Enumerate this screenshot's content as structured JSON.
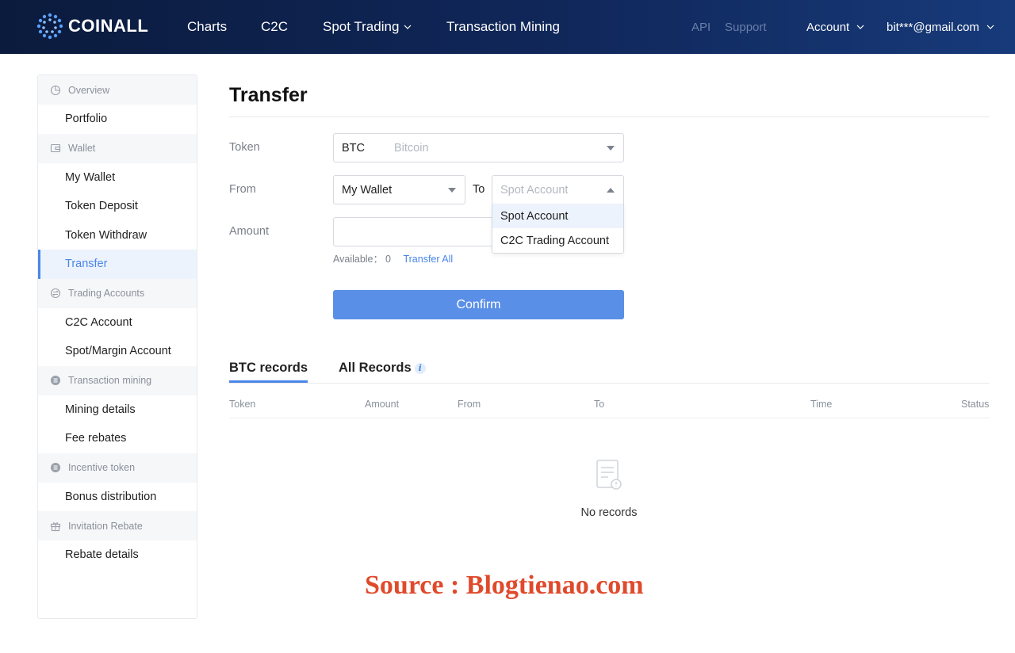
{
  "header": {
    "logo_text": "COINALL",
    "nav": [
      {
        "label": "Charts"
      },
      {
        "label": "C2C"
      },
      {
        "label": "Spot Trading"
      },
      {
        "label": "Transaction Mining"
      }
    ],
    "right": {
      "api": "API",
      "support": "Support",
      "account": "Account",
      "user": "bit***@gmail.com"
    }
  },
  "sidebar": {
    "groups": [
      {
        "label": "Overview",
        "icon": "pie-chart-icon",
        "items": [
          "Portfolio"
        ]
      },
      {
        "label": "Wallet",
        "icon": "wallet-icon",
        "items": [
          "My Wallet",
          "Token Deposit",
          "Token Withdraw",
          "Transfer"
        ]
      },
      {
        "label": "Trading Accounts",
        "icon": "exchange-icon",
        "items": [
          "C2C Account",
          "Spot/Margin Account"
        ]
      },
      {
        "label": "Transaction mining",
        "icon": "mining-icon",
        "items": [
          "Mining details",
          "Fee rebates"
        ]
      },
      {
        "label": "Incentive token",
        "icon": "token-icon",
        "items": [
          "Bonus distribution"
        ]
      },
      {
        "label": "Invitation Rebate",
        "icon": "gift-icon",
        "items": [
          "Rebate details"
        ]
      }
    ],
    "active_item": "Transfer"
  },
  "transfer": {
    "title": "Transfer",
    "token_label": "Token",
    "token_symbol": "BTC",
    "token_name": "Bitcoin",
    "from_label": "From",
    "from_value": "My Wallet",
    "to_label": "To",
    "to_placeholder": "Spot Account",
    "to_options": [
      "Spot Account",
      "C2C Trading Account"
    ],
    "amount_label": "Amount",
    "amount_value": "",
    "available_label": "Available：",
    "available_value": "0",
    "transfer_all": "Transfer All",
    "confirm": "Confirm"
  },
  "records": {
    "tabs": [
      {
        "label": "BTC records"
      },
      {
        "label": "All Records"
      }
    ],
    "info_glyph": "i",
    "columns": [
      "Token",
      "Amount",
      "From",
      "To",
      "Time",
      "Status"
    ],
    "empty_text": "No records"
  },
  "watermark": "Source : Blogtienao.com",
  "colors": {
    "accent": "#4a86e8",
    "button": "#5a8fe8",
    "header_bg": "#0b1b3d",
    "watermark": "#e04a2c"
  }
}
